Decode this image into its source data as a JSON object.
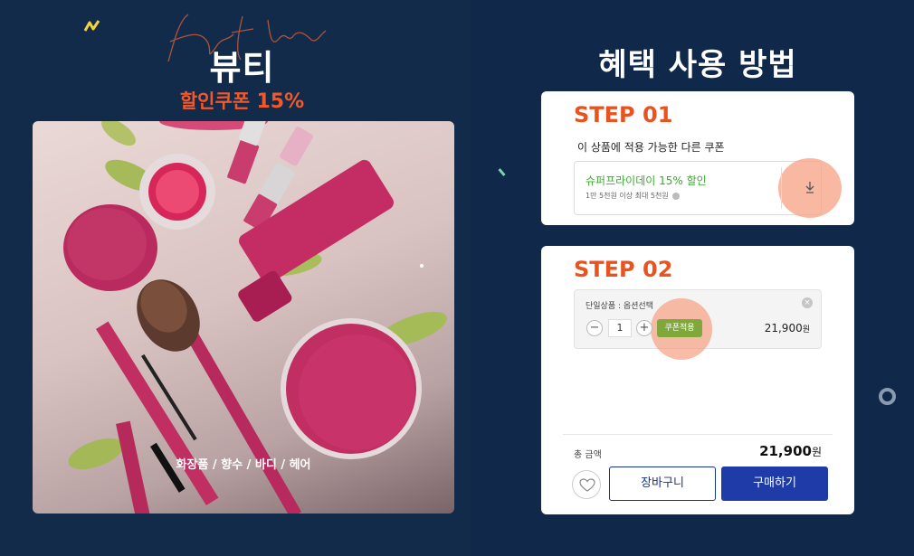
{
  "left": {
    "script_word": "Ket Word",
    "title": "뷰티",
    "subtitle_text": "할인쿠폰",
    "subtitle_pct": "15%",
    "photo_caption": "화장품 / 향수 / 바디 / 헤어"
  },
  "right": {
    "title": "혜택 사용 방법",
    "step1": {
      "label": "STEP 01",
      "heading": "이 상품에 적용 가능한 다른 쿠폰",
      "coupon_name": "슈퍼프라이데이 15% 할인",
      "coupon_note": "1만 5천원 이상 최대 5천원",
      "download_icon": "download-arrow-icon"
    },
    "step2": {
      "label": "STEP 02",
      "option_label": "단일상품 : 옵션선택",
      "qty_minus": "−",
      "qty_value": "1",
      "qty_plus": "+",
      "apply_label": "쿠폰적용",
      "option_price": "21,900",
      "option_price_unit": "원",
      "close_icon": "×",
      "total_label": "총 금액",
      "total_price": "21,900",
      "total_price_unit": "원",
      "cart_label": "장바구니",
      "buy_label": "구매하기"
    }
  },
  "colors": {
    "background": "#10294a",
    "accent_orange": "#e8531f",
    "coupon_green": "#3aab2f",
    "apply_green": "#7fa73c",
    "buy_blue": "#1e3ba8",
    "highlight_pink": "#f7a082"
  }
}
